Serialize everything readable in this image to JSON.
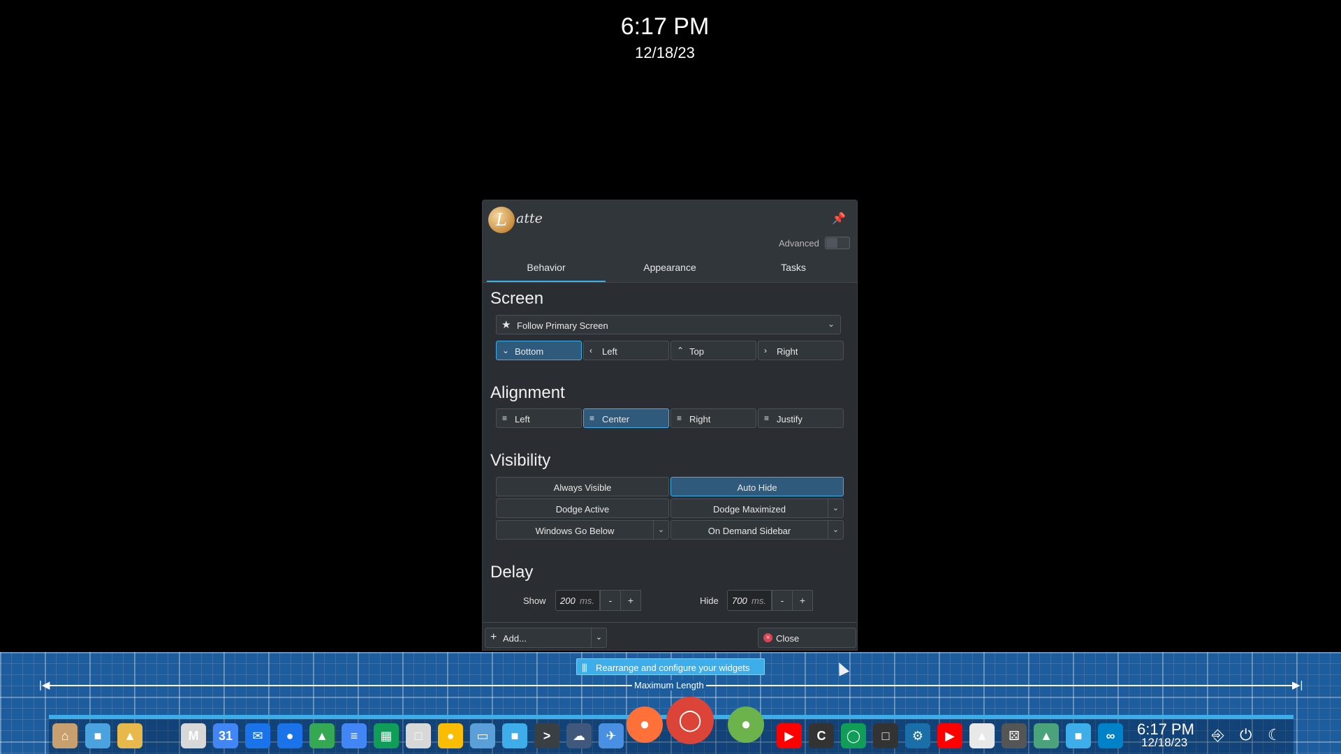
{
  "desktop": {
    "time": "6:17 PM",
    "date": "12/18/23"
  },
  "window": {
    "logo_glyph": "L",
    "logo_text": "atte",
    "pin_icon": "pin-icon",
    "advanced_label": "Advanced",
    "tabs": [
      {
        "label": "Behavior",
        "active": true
      },
      {
        "label": "Appearance",
        "active": false
      },
      {
        "label": "Tasks",
        "active": false
      }
    ],
    "screen": {
      "title": "Screen",
      "combo_value": "Follow Primary Screen",
      "edges": [
        {
          "label": "Bottom",
          "icon": "chevron-down-icon",
          "selected": true
        },
        {
          "label": "Left",
          "icon": "chevron-left-icon",
          "selected": false
        },
        {
          "label": "Top",
          "icon": "chevron-up-icon",
          "selected": false
        },
        {
          "label": "Right",
          "icon": "chevron-right-icon",
          "selected": false
        }
      ]
    },
    "alignment": {
      "title": "Alignment",
      "options": [
        {
          "label": "Left",
          "icon": "align-left-icon",
          "selected": false
        },
        {
          "label": "Center",
          "icon": "align-center-icon",
          "selected": true
        },
        {
          "label": "Right",
          "icon": "align-right-icon",
          "selected": false
        },
        {
          "label": "Justify",
          "icon": "align-justify-icon",
          "selected": false
        }
      ]
    },
    "visibility": {
      "title": "Visibility",
      "options": [
        {
          "label": "Always Visible",
          "selected": false
        },
        {
          "label": "Auto Hide",
          "selected": true
        },
        {
          "label": "Dodge Active",
          "selected": false
        },
        {
          "label": "Dodge Maximized",
          "selected": false
        },
        {
          "label": "Windows Go Below",
          "selected": false
        },
        {
          "label": "On Demand Sidebar",
          "selected": false
        }
      ]
    },
    "delay": {
      "title": "Delay",
      "show_label": "Show",
      "show_value": "200",
      "hide_label": "Hide",
      "hide_value": "700",
      "unit": "ms.",
      "minus": "-",
      "plus": "+"
    },
    "footer": {
      "add_label": "Add...",
      "close_label": "Close"
    }
  },
  "dock": {
    "rearrange_label": "Rearrange and configure your widgets",
    "max_length_label": "Maximum Length",
    "tray": {
      "time": "6:17 PM",
      "date": "12/18/23"
    },
    "apps": [
      {
        "name": "home-icon",
        "color": "#c8a070"
      },
      {
        "name": "files-icon",
        "color": "#4aa3df"
      },
      {
        "name": "keep-icon",
        "color": "#e8b84a"
      },
      {
        "name": "gmail-icon",
        "color": "#d8d8d8"
      },
      {
        "name": "calendar-icon",
        "color": "#4285f4"
      },
      {
        "name": "messages-icon",
        "color": "#1a73e8"
      },
      {
        "name": "contacts-icon",
        "color": "#1a73e8"
      },
      {
        "name": "drive-icon",
        "color": "#34a853"
      },
      {
        "name": "docs-icon",
        "color": "#4285f4"
      },
      {
        "name": "sheets-icon",
        "color": "#0f9d58"
      },
      {
        "name": "text-editor-icon",
        "color": "#d8d8d8"
      },
      {
        "name": "keep-notes-icon",
        "color": "#fbbc04"
      },
      {
        "name": "window-icon",
        "color": "#5aa0d8"
      },
      {
        "name": "folder-icon",
        "color": "#3daee9"
      },
      {
        "name": "terminal-icon",
        "color": "#3a3f44"
      },
      {
        "name": "cloud-icon",
        "color": "#40587c"
      },
      {
        "name": "plane-icon",
        "color": "#4a90e2"
      },
      {
        "name": "firefox-icon",
        "color": "#ff7139"
      },
      {
        "name": "chrome-icon",
        "color": "#db4437"
      },
      {
        "name": "keepassxc-icon",
        "color": "#6bb34a"
      },
      {
        "name": "youtube-icon",
        "color": "#ff0000"
      },
      {
        "name": "christian-pc-icon",
        "color": "#333333"
      },
      {
        "name": "chrome-alt-icon",
        "color": "#0f9d58"
      },
      {
        "name": "notes-icon",
        "color": "#333333"
      },
      {
        "name": "steam-icon",
        "color": "#1b6fa8"
      },
      {
        "name": "youtube-music-icon",
        "color": "#ff0000"
      },
      {
        "name": "arch-icon",
        "color": "#e8e8e8"
      },
      {
        "name": "dice-icon",
        "color": "#555555"
      },
      {
        "name": "system-monitor-icon",
        "color": "#4aa37a"
      },
      {
        "name": "folder-alt-icon",
        "color": "#3daee9"
      },
      {
        "name": "nextcloud-icon",
        "color": "#0082c9"
      }
    ]
  }
}
